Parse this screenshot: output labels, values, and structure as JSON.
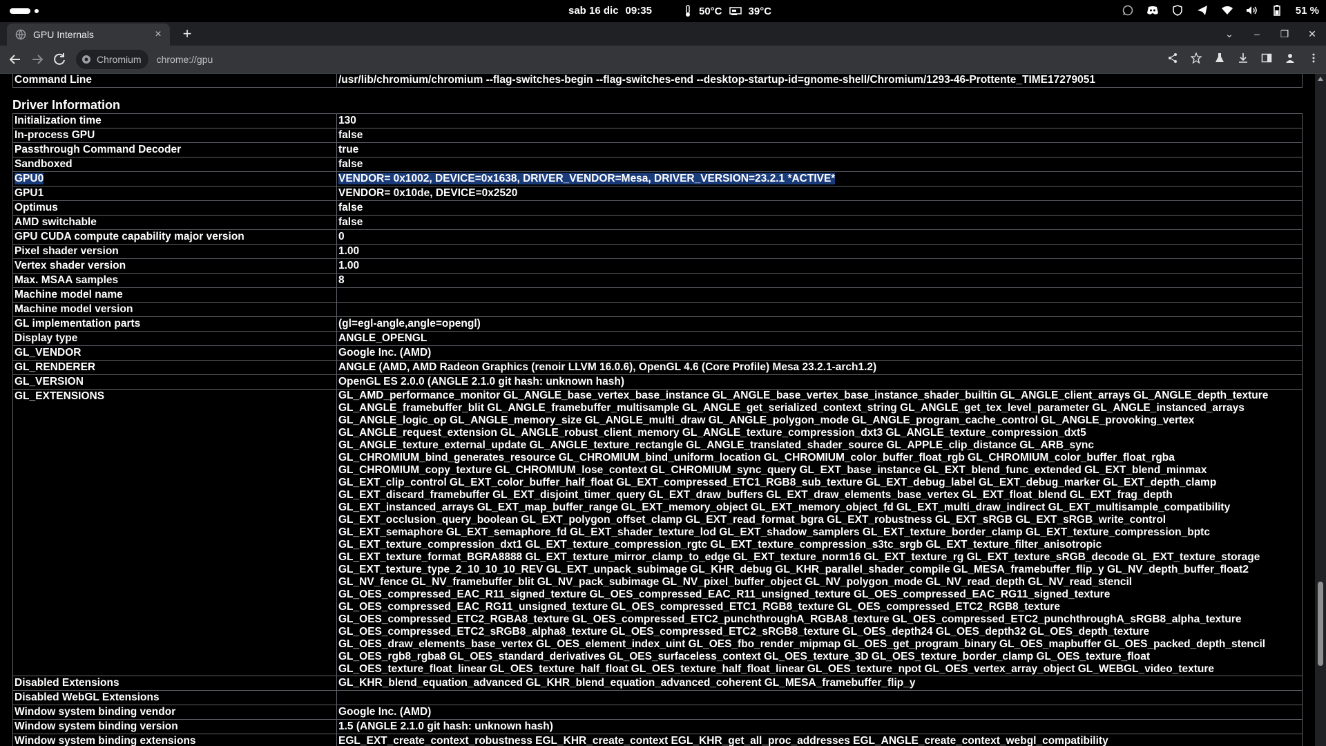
{
  "topbar": {
    "date": "sab 16 dic",
    "time": "09:35",
    "cpu_temp": "50°C",
    "gpu_temp": "39°C",
    "battery": "51 %"
  },
  "tab": {
    "title": "GPU Internals",
    "close": "×",
    "new_tab": "+"
  },
  "window_controls": {
    "dropdown": "⌄",
    "minimize": "–",
    "restore": "❐",
    "close": "✕"
  },
  "omnibox": {
    "chip": "Chromium",
    "url": "chrome://gpu"
  },
  "command_line": {
    "label": "Command Line",
    "value": "/usr/lib/chromium/chromium --flag-switches-begin --flag-switches-end --desktop-startup-id=gnome-shell/Chromium/1293-46-Prottente_TIME17279051"
  },
  "driver_info": {
    "title": "Driver Information",
    "rows": [
      {
        "k": "Initialization time",
        "v": "130"
      },
      {
        "k": "In-process GPU",
        "v": "false"
      },
      {
        "k": "Passthrough Command Decoder",
        "v": "true"
      },
      {
        "k": "Sandboxed",
        "v": "false"
      },
      {
        "k": "GPU0",
        "v": "VENDOR= 0x1002, DEVICE=0x1638, DRIVER_VENDOR=Mesa, DRIVER_VERSION=23.2.1 *ACTIVE*"
      },
      {
        "k": "GPU1",
        "v": "VENDOR= 0x10de, DEVICE=0x2520"
      },
      {
        "k": "Optimus",
        "v": "false"
      },
      {
        "k": "AMD switchable",
        "v": "false"
      },
      {
        "k": "GPU CUDA compute capability major version",
        "v": "0"
      },
      {
        "k": "Pixel shader version",
        "v": "1.00"
      },
      {
        "k": "Vertex shader version",
        "v": "1.00"
      },
      {
        "k": "Max. MSAA samples",
        "v": "8"
      },
      {
        "k": "Machine model name",
        "v": ""
      },
      {
        "k": "Machine model version",
        "v": ""
      },
      {
        "k": "GL implementation parts",
        "v": "(gl=egl-angle,angle=opengl)"
      },
      {
        "k": "Display type",
        "v": "ANGLE_OPENGL"
      },
      {
        "k": "GL_VENDOR",
        "v": "Google Inc. (AMD)"
      },
      {
        "k": "GL_RENDERER",
        "v": "ANGLE (AMD, AMD Radeon Graphics (renoir LLVM 16.0.6), OpenGL 4.6 (Core Profile) Mesa 23.2.1-arch1.2)"
      },
      {
        "k": "GL_VERSION",
        "v": "OpenGL ES 2.0.0 (ANGLE 2.1.0 git hash: unknown hash)"
      }
    ],
    "extensions_label": "GL_EXTENSIONS",
    "extensions_lines": [
      "GL_AMD_performance_monitor GL_ANGLE_base_vertex_base_instance GL_ANGLE_base_vertex_base_instance_shader_builtin GL_ANGLE_client_arrays GL_ANGLE_depth_texture",
      "GL_ANGLE_framebuffer_blit GL_ANGLE_framebuffer_multisample GL_ANGLE_get_serialized_context_string GL_ANGLE_get_tex_level_parameter GL_ANGLE_instanced_arrays",
      "GL_ANGLE_logic_op GL_ANGLE_memory_size GL_ANGLE_multi_draw GL_ANGLE_polygon_mode GL_ANGLE_program_cache_control GL_ANGLE_provoking_vertex",
      "GL_ANGLE_request_extension GL_ANGLE_robust_client_memory GL_ANGLE_texture_compression_dxt3 GL_ANGLE_texture_compression_dxt5",
      "GL_ANGLE_texture_external_update GL_ANGLE_texture_rectangle GL_ANGLE_translated_shader_source GL_APPLE_clip_distance GL_ARB_sync",
      "GL_CHROMIUM_bind_generates_resource GL_CHROMIUM_bind_uniform_location GL_CHROMIUM_color_buffer_float_rgb GL_CHROMIUM_color_buffer_float_rgba",
      "GL_CHROMIUM_copy_texture GL_CHROMIUM_lose_context GL_CHROMIUM_sync_query GL_EXT_base_instance GL_EXT_blend_func_extended GL_EXT_blend_minmax",
      "GL_EXT_clip_control GL_EXT_color_buffer_half_float GL_EXT_compressed_ETC1_RGB8_sub_texture GL_EXT_debug_label GL_EXT_debug_marker GL_EXT_depth_clamp",
      "GL_EXT_discard_framebuffer GL_EXT_disjoint_timer_query GL_EXT_draw_buffers GL_EXT_draw_elements_base_vertex GL_EXT_float_blend GL_EXT_frag_depth",
      "GL_EXT_instanced_arrays GL_EXT_map_buffer_range GL_EXT_memory_object GL_EXT_memory_object_fd GL_EXT_multi_draw_indirect GL_EXT_multisample_compatibility",
      "GL_EXT_occlusion_query_boolean GL_EXT_polygon_offset_clamp GL_EXT_read_format_bgra GL_EXT_robustness GL_EXT_sRGB GL_EXT_sRGB_write_control",
      "GL_EXT_semaphore GL_EXT_semaphore_fd GL_EXT_shader_texture_lod GL_EXT_shadow_samplers GL_EXT_texture_border_clamp GL_EXT_texture_compression_bptc",
      "GL_EXT_texture_compression_dxt1 GL_EXT_texture_compression_rgtc GL_EXT_texture_compression_s3tc_srgb GL_EXT_texture_filter_anisotropic",
      "GL_EXT_texture_format_BGRA8888 GL_EXT_texture_mirror_clamp_to_edge GL_EXT_texture_norm16 GL_EXT_texture_rg GL_EXT_texture_sRGB_decode GL_EXT_texture_storage",
      "GL_EXT_texture_type_2_10_10_10_REV GL_EXT_unpack_subimage GL_KHR_debug GL_KHR_parallel_shader_compile GL_MESA_framebuffer_flip_y GL_NV_depth_buffer_float2",
      "GL_NV_fence GL_NV_framebuffer_blit GL_NV_pack_subimage GL_NV_pixel_buffer_object GL_NV_polygon_mode GL_NV_read_depth GL_NV_read_stencil",
      "GL_OES_compressed_EAC_R11_signed_texture GL_OES_compressed_EAC_R11_unsigned_texture GL_OES_compressed_EAC_RG11_signed_texture",
      "GL_OES_compressed_EAC_RG11_unsigned_texture GL_OES_compressed_ETC1_RGB8_texture GL_OES_compressed_ETC2_RGB8_texture",
      "GL_OES_compressed_ETC2_RGBA8_texture GL_OES_compressed_ETC2_punchthroughA_RGBA8_texture GL_OES_compressed_ETC2_punchthroughA_sRGB8_alpha_texture",
      "GL_OES_compressed_ETC2_sRGB8_alpha8_texture GL_OES_compressed_ETC2_sRGB8_texture GL_OES_depth24 GL_OES_depth32 GL_OES_depth_texture",
      "GL_OES_draw_elements_base_vertex GL_OES_element_index_uint GL_OES_fbo_render_mipmap GL_OES_get_program_binary GL_OES_mapbuffer GL_OES_packed_depth_stencil",
      "GL_OES_rgb8_rgba8 GL_OES_standard_derivatives GL_OES_surfaceless_context GL_OES_texture_3D GL_OES_texture_border_clamp GL_OES_texture_float",
      "GL_OES_texture_float_linear GL_OES_texture_half_float GL_OES_texture_half_float_linear GL_OES_texture_npot GL_OES_vertex_array_object GL_WEBGL_video_texture"
    ],
    "rows_after": [
      {
        "k": "Disabled Extensions",
        "v": "GL_KHR_blend_equation_advanced GL_KHR_blend_equation_advanced_coherent GL_MESA_framebuffer_flip_y"
      },
      {
        "k": "Disabled WebGL Extensions",
        "v": ""
      },
      {
        "k": "Window system binding vendor",
        "v": "Google Inc. (AMD)"
      },
      {
        "k": "Window system binding version",
        "v": "1.5 (ANGLE 2.1.0 git hash: unknown hash)"
      },
      {
        "k": "Window system binding extensions",
        "v": "EGL_EXT_create_context_robustness EGL_KHR_create_context EGL_KHR_get_all_proc_addresses EGL_ANGLE_create_context_webgl_compatibility"
      }
    ]
  }
}
